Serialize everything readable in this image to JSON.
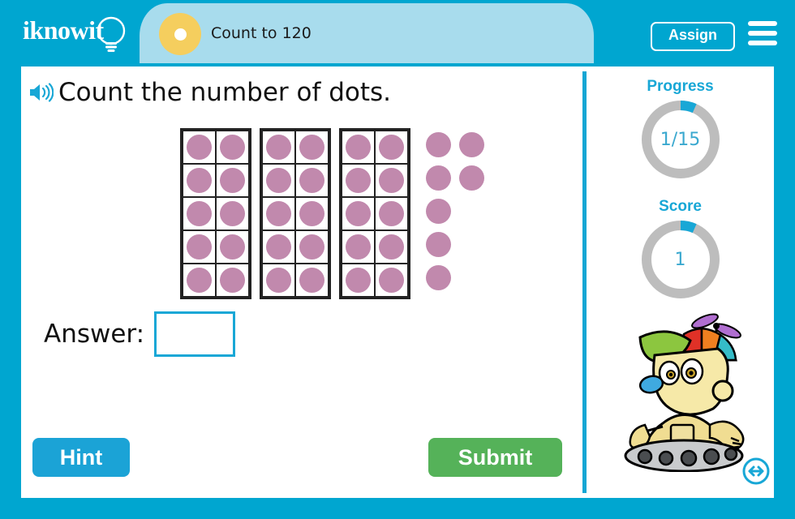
{
  "app": {
    "brand": "iknowit",
    "accent_cyan": "#00a6d0",
    "tab_blue": "#a8dced",
    "dot_color": "#c189ad",
    "green": "#55b259",
    "gold": "#f5ce5e"
  },
  "header": {
    "logo_text": "iknowit",
    "logo_icon": "lightbulb-icon",
    "lesson_title": "Count to 120",
    "badge_icon": "lesson-badge-icon",
    "assign_label": "Assign",
    "menu_icon": "hamburger-menu-icon"
  },
  "question": {
    "speaker_icon": "speaker-audio-icon",
    "text": "Count the number of dots."
  },
  "answer": {
    "label": "Answer:",
    "value": "",
    "placeholder": ""
  },
  "actions": {
    "hint_label": "Hint",
    "submit_label": "Submit"
  },
  "sidebar": {
    "progress": {
      "label": "Progress",
      "value": "1/15",
      "current": 1,
      "total": 15,
      "percent": 6.7,
      "arc_color": "#18a7d6",
      "track_color": "#bdbdbd"
    },
    "score": {
      "label": "Score",
      "value": "1",
      "current": 1,
      "percent": 6.7,
      "arc_color": "#18a7d6",
      "track_color": "#bdbdbd"
    },
    "mascot_icon": "robot-mascot-icon",
    "nav_toggle_icon": "left-right-arrow-icon"
  },
  "chart_data": {
    "type": "table",
    "title": "Count the number of dots.",
    "description": "Three filled ten-frames plus seven loose dots",
    "total_dots": 37,
    "ten_frames": [
      {
        "rows": 5,
        "cols": 2,
        "filled": 10
      },
      {
        "rows": 5,
        "cols": 2,
        "filled": 10
      },
      {
        "rows": 5,
        "cols": 2,
        "filled": 10
      }
    ],
    "loose_dots": {
      "count": 7,
      "rows": [
        2,
        2,
        1,
        1,
        1
      ]
    }
  }
}
